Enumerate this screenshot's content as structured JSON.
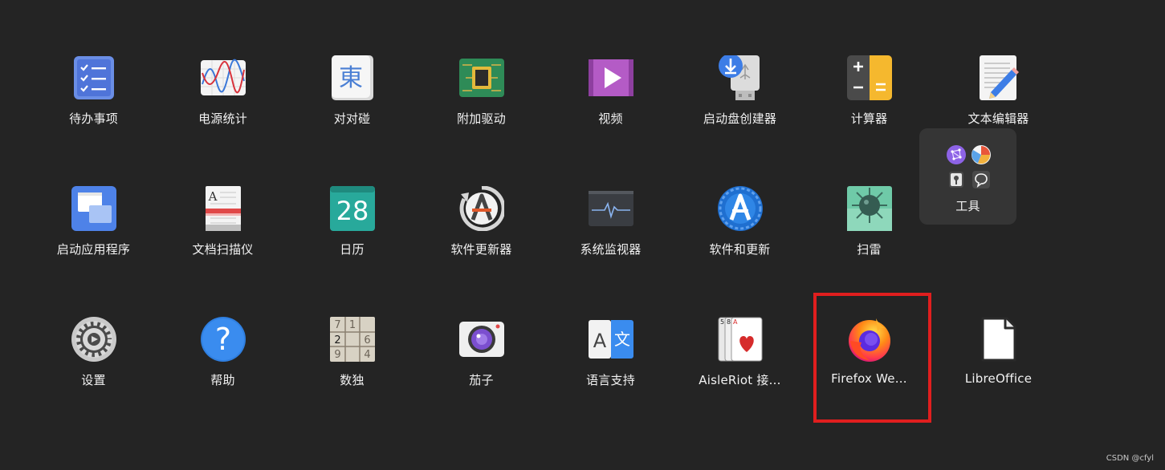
{
  "apps": [
    {
      "label": "待办事项",
      "icon": "todo-checklist-icon"
    },
    {
      "label": "电源统计",
      "icon": "power-statistics-chart-icon"
    },
    {
      "label": "对对碰",
      "icon": "mahjongg-tile-icon",
      "glyph": "東"
    },
    {
      "label": "附加驱动",
      "icon": "chip-driver-icon"
    },
    {
      "label": "视频",
      "icon": "video-play-icon"
    },
    {
      "label": "启动盘创建器",
      "icon": "usb-download-icon"
    },
    {
      "label": "计算器",
      "icon": "calculator-icon"
    },
    {
      "label": "文本编辑器",
      "icon": "text-editor-pencil-icon"
    },
    {
      "label": "启动应用程序",
      "icon": "startup-windows-icon"
    },
    {
      "label": "文档扫描仪",
      "icon": "document-scanner-icon",
      "glyph": "A"
    },
    {
      "label": "日历",
      "icon": "calendar-icon",
      "glyph": "28"
    },
    {
      "label": "软件更新器",
      "icon": "software-updater-icon"
    },
    {
      "label": "系统监视器",
      "icon": "system-monitor-icon"
    },
    {
      "label": "软件和更新",
      "icon": "software-sources-icon"
    },
    {
      "label": "扫雷",
      "icon": "mines-icon"
    },
    {
      "label": "设置",
      "icon": "settings-gear-icon"
    },
    {
      "label": "帮助",
      "icon": "help-question-icon",
      "glyph": "?"
    },
    {
      "label": "数独",
      "icon": "sudoku-grid-icon",
      "cells": [
        "7",
        "1",
        "",
        "2",
        "",
        "6",
        "9",
        "",
        "4"
      ]
    },
    {
      "label": "茄子",
      "icon": "cheese-camera-icon"
    },
    {
      "label": "语言支持",
      "icon": "language-support-icon",
      "glyphs": [
        "A",
        "文"
      ]
    },
    {
      "label": "AisleRiot 接…",
      "icon": "playing-cards-icon",
      "glyphs": [
        "5",
        "8",
        "A"
      ]
    },
    {
      "label": "Firefox We…",
      "icon": "firefox-icon"
    },
    {
      "label": "LibreOffice",
      "icon": "libreoffice-icon"
    }
  ],
  "folder": {
    "label": "工具",
    "icons": [
      "network-icon",
      "disk-usage-icon",
      "usb-key-icon",
      "chat-bubble-icon"
    ]
  },
  "highlight": {
    "target": "Firefox We…",
    "color": "#e01e1e"
  },
  "watermark": "CSDN @cfyl",
  "colors": {
    "background": "#242424",
    "folder": "#353535",
    "text": "#f2f2f2"
  }
}
